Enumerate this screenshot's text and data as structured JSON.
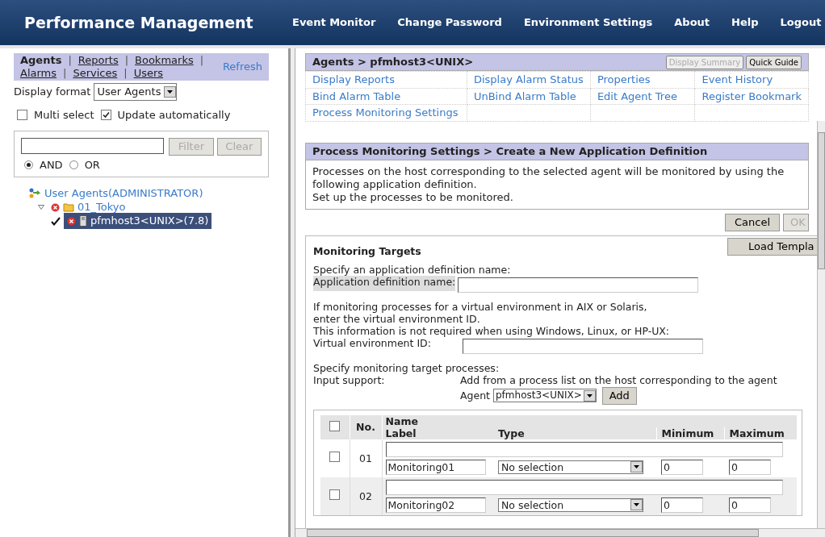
{
  "header": {
    "title": "Performance Management",
    "nav": [
      "Event Monitor",
      "Change Password",
      "Environment Settings",
      "About",
      "Help",
      "Logout"
    ]
  },
  "sidebar": {
    "tabs": [
      {
        "label": "Agents",
        "selected": true
      },
      {
        "label": "Reports",
        "selected": false
      },
      {
        "label": "Bookmarks",
        "selected": false
      },
      {
        "label": "Alarms",
        "selected": false
      },
      {
        "label": "Services",
        "selected": false
      },
      {
        "label": "Users",
        "selected": false
      }
    ],
    "tab_separator": "|",
    "refresh": "Refresh",
    "display_format": {
      "label": "Display format",
      "value": "User Agents"
    },
    "options": [
      {
        "label": "Multi select",
        "checked": false
      },
      {
        "label": "Update automatically",
        "checked": true
      }
    ],
    "filter": {
      "filter_button": "Filter",
      "clear_button": "Clear",
      "modes": [
        {
          "label": "AND",
          "selected": true
        },
        {
          "label": "OR",
          "selected": false
        }
      ]
    },
    "tree": [
      {
        "label": "User Agents(ADMINISTRATOR)",
        "kind": "root",
        "children": [
          {
            "label": "01_Tokyo",
            "kind": "folder",
            "expanded": true,
            "children": [
              {
                "label": "pfmhost3<UNIX>(7.8)",
                "kind": "host",
                "selected": true,
                "checked": true
              }
            ]
          }
        ]
      }
    ]
  },
  "agent_panel": {
    "title": "Agents > pfmhost3<UNIX>",
    "buttons": [
      {
        "label": "Display Summary",
        "disabled": true
      },
      {
        "label": "Quick Guide",
        "disabled": false
      }
    ],
    "links": [
      [
        "Display Reports",
        "Display Alarm Status",
        "Properties",
        "Event History"
      ],
      [
        "Bind Alarm Table",
        "UnBind Alarm Table",
        "Edit Agent Tree",
        "Register Bookmark"
      ],
      [
        "Process Monitoring Settings"
      ]
    ]
  },
  "definition_panel": {
    "title": "Process Monitoring Settings >  Create a New Application Definition",
    "description": [
      "Processes on the host corresponding to the selected agent will be monitored by using the following application definition.",
      "Set up the processes to be monitored."
    ],
    "buttons": [
      {
        "label": "Cancel",
        "disabled": false
      },
      {
        "label": "OK",
        "disabled": true
      }
    ]
  },
  "monitoring_targets": {
    "title": "Monitoring Targets",
    "load_button": "Load Templa",
    "name_prompt": "Specify an application definition name:",
    "name_label": "Application definition name:",
    "virtual_note": [
      "If monitoring processes for a virtual environment in AIX or Solaris,",
      "enter the virtual environment ID.",
      "This information is not required when using Windows, Linux, or HP-UX:"
    ],
    "virtual_label": "Virtual environment ID:",
    "process_prompt": "Specify monitoring target processes:",
    "input_support_label": "Input support:",
    "input_support_text": "Add from a process list on the host corresponding to the agent",
    "agent_label": "Agent",
    "agent_value": "pfmhost3<UNIX>",
    "add_button": "Add",
    "table": {
      "select_all": false,
      "columns": [
        "No.",
        "Name",
        "Label",
        "Type",
        "Minimum",
        "Maximum"
      ],
      "rows": [
        {
          "checked": false,
          "no": "01",
          "label": "Monitoring01",
          "type": "No selection",
          "minimum": "0",
          "maximum": "0"
        },
        {
          "checked": false,
          "no": "02",
          "label": "Monitoring02",
          "type": "No selection",
          "minimum": "0",
          "maximum": "0"
        }
      ]
    }
  }
}
